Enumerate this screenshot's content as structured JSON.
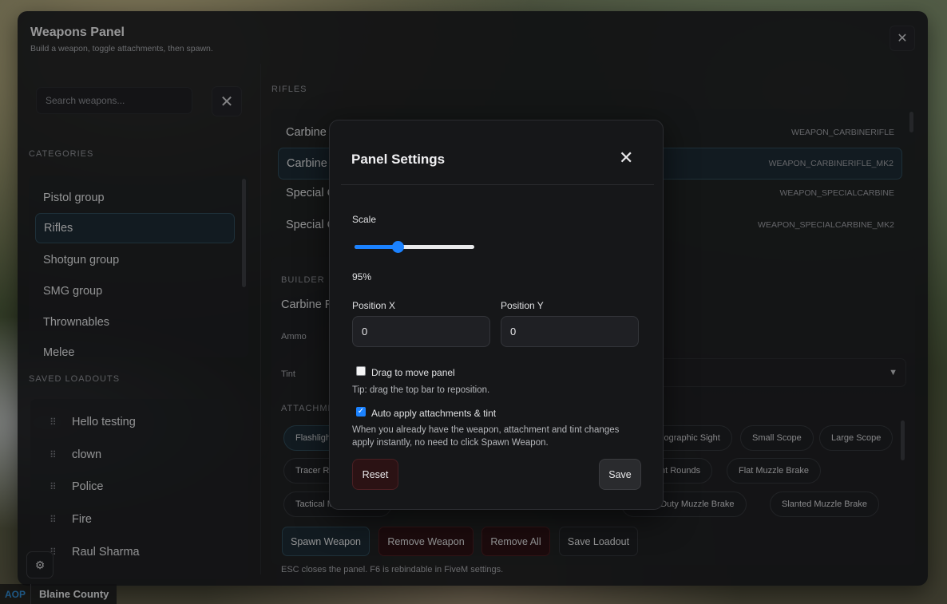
{
  "panel": {
    "title": "Weapons Panel",
    "subtitle": "Build a weapon, toggle attachments, then spawn.",
    "close_icon": "✕"
  },
  "search": {
    "placeholder": "Search weapons...",
    "value": "",
    "clear_icon": "✕"
  },
  "categories": {
    "label": "CATEGORIES",
    "items": [
      "Pistol group",
      "Rifles",
      "Shotgun group",
      "SMG group",
      "Thrownables",
      "Melee"
    ],
    "active": "Rifles"
  },
  "loadouts": {
    "label": "SAVED LOADOUTS",
    "items": [
      "Hello testing",
      "clown",
      "Police",
      "Fire",
      "Raul Sharma"
    ]
  },
  "rifles": {
    "label": "RIFLES",
    "rows": [
      {
        "name": "Carbine Rifle",
        "code": "WEAPON_CARBINERIFLE"
      },
      {
        "name": "Carbine Rifle Mk II",
        "code": "WEAPON_CARBINERIFLE_MK2"
      },
      {
        "name": "Special Carbine",
        "code": "WEAPON_SPECIALCARBINE"
      },
      {
        "name": "Special Carbine Mk II",
        "code": "WEAPON_SPECIALCARBINE_MK2"
      }
    ]
  },
  "builder": {
    "label": "BUILDER",
    "weapon_name": "Carbine Rifle Mk II",
    "ammo_label": "Ammo",
    "tint_label": "Tint",
    "attachments_label": "ATTACHMENTS",
    "chips_row1": [
      "Flashlight",
      "Holographic Sight",
      "Small Scope",
      "Large Scope"
    ],
    "chips_row2": [
      "Tracer Rounds",
      "Hollow Point Rounds",
      "Flat Muzzle Brake"
    ],
    "chips_row3": [
      "Tactical Muzzle Brake",
      "Heavy Duty Muzzle Brake",
      "Slanted Muzzle Brake"
    ]
  },
  "actions": {
    "spawn": "Spawn Weapon",
    "remove": "Remove Weapon",
    "remove_all": "Remove All",
    "save_loadout": "Save Loadout",
    "note": "ESC closes the panel. F6 is rebindable in FiveM settings."
  },
  "aop": {
    "label": "AOP",
    "value": "Blaine County"
  },
  "settings": {
    "title": "Panel Settings",
    "close_icon": "✕",
    "scale_label": "Scale",
    "scale_value": "95%",
    "scale_fraction": 0.36,
    "pos_x_label": "Position X",
    "pos_x_value": "0",
    "pos_y_label": "Position Y",
    "pos_y_value": "0",
    "drag_label": "Drag to move panel",
    "drag_checked": false,
    "drag_tip": "Tip: drag the top bar to reposition.",
    "auto_label": "Auto apply attachments & tint",
    "auto_checked": true,
    "auto_desc_1": "When you already have the weapon, attachment and tint changes",
    "auto_desc_2": "apply instantly, no need to click Spawn Weapon.",
    "reset": "Reset",
    "save": "Save"
  },
  "colors": {
    "accent": "#1b82ff",
    "danger_bg": "#2b1214",
    "panel_bg": "#1a1b1e"
  },
  "icons": {
    "gear": "⚙",
    "grip": "⠿",
    "chevron": "▼"
  }
}
